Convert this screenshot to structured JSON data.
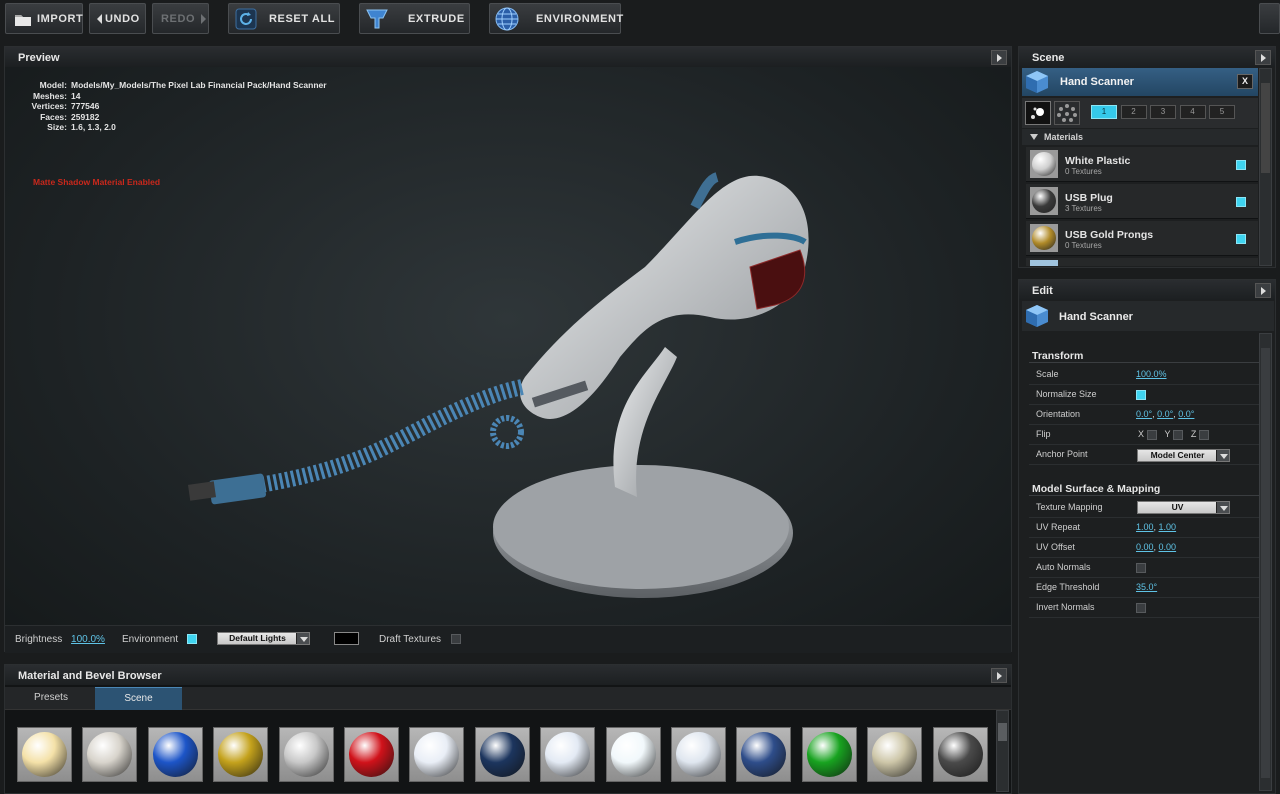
{
  "toolbar": {
    "import": "IMPORT",
    "undo": "UNDO",
    "redo": "REDO",
    "reset_all": "RESET ALL",
    "extrude": "EXTRUDE",
    "environment": "ENVIRONMENT"
  },
  "preview": {
    "title": "Preview",
    "info": [
      {
        "k": "Model:",
        "v": "Models/My_Models/The Pixel Lab Financial Pack/Hand Scanner"
      },
      {
        "k": "Meshes:",
        "v": "14"
      },
      {
        "k": "Vertices:",
        "v": "777546"
      },
      {
        "k": "Faces:",
        "v": "259182"
      },
      {
        "k": "Size:",
        "v": "1.6, 1.3, 2.0"
      }
    ],
    "warning": "Matte Shadow Material Enabled",
    "controls": {
      "brightness_label": "Brightness",
      "brightness_value": "100.0%",
      "environment_label": "Environment",
      "lights_value": "Default Lights",
      "draft_label": "Draft Textures"
    }
  },
  "browser": {
    "title": "Material and Bevel Browser",
    "tabs": [
      "Presets",
      "Scene"
    ],
    "active_tab": "Scene",
    "thumbs": [
      {
        "name": "glow",
        "color": "#f4e1a8"
      },
      {
        "name": "pearl",
        "color": "#d8d4cc"
      },
      {
        "name": "blue gloss",
        "color": "#1d55c8"
      },
      {
        "name": "gold",
        "color": "#c4a21c"
      },
      {
        "name": "striped chrome",
        "color": "#c8c8c8"
      },
      {
        "name": "red gloss",
        "color": "#d0121a"
      },
      {
        "name": "flag sphere",
        "color": "#e9eef6"
      },
      {
        "name": "navy",
        "color": "#1c355e"
      },
      {
        "name": "flag sphere 2",
        "color": "#e3eaf4"
      },
      {
        "name": "white",
        "color": "#f1f8fb"
      },
      {
        "name": "flag sphere 3",
        "color": "#dfe6ef"
      },
      {
        "name": "logo sphere",
        "color": "#2e4d8a"
      },
      {
        "name": "green",
        "color": "#18a320"
      },
      {
        "name": "beige",
        "color": "#cdc6a8"
      },
      {
        "name": "dark grey",
        "color": "#4a4a4a"
      }
    ]
  },
  "scene": {
    "title": "Scene",
    "object": "Hand Scanner",
    "close": "X",
    "layers": [
      "1",
      "2",
      "3",
      "4",
      "5"
    ],
    "materials_label": "Materials",
    "materials": [
      {
        "name": "White Plastic",
        "textures": "0 Textures",
        "color": "#cfcfcf"
      },
      {
        "name": "USB Plug",
        "textures": "3 Textures",
        "color": "#3a3a3a"
      },
      {
        "name": "USB Gold Prongs",
        "textures": "0 Textures",
        "color": "#b08a28"
      }
    ]
  },
  "edit": {
    "title": "Edit",
    "object": "Hand Scanner",
    "transform_title": "Transform",
    "scale_label": "Scale",
    "scale_value": "100.0%",
    "normalize_label": "Normalize Size",
    "orientation_label": "Orientation",
    "orientation_value": [
      "0.0°",
      "0.0°",
      "0.0°"
    ],
    "flip_label": "Flip",
    "flip_axes": [
      "X",
      "Y",
      "Z"
    ],
    "anchor_label": "Anchor Point",
    "anchor_value": "Model Center",
    "surface_title": "Model Surface & Mapping",
    "texture_label": "Texture Mapping",
    "texture_value": "UV",
    "uv_repeat_label": "UV Repeat",
    "uv_repeat_value": [
      "1.00",
      "1.00"
    ],
    "uv_offset_label": "UV Offset",
    "uv_offset_value": [
      "0.00",
      "0.00"
    ],
    "auto_normals_label": "Auto Normals",
    "edge_label": "Edge Threshold",
    "edge_value": "35.0°",
    "invert_label": "Invert Normals"
  }
}
